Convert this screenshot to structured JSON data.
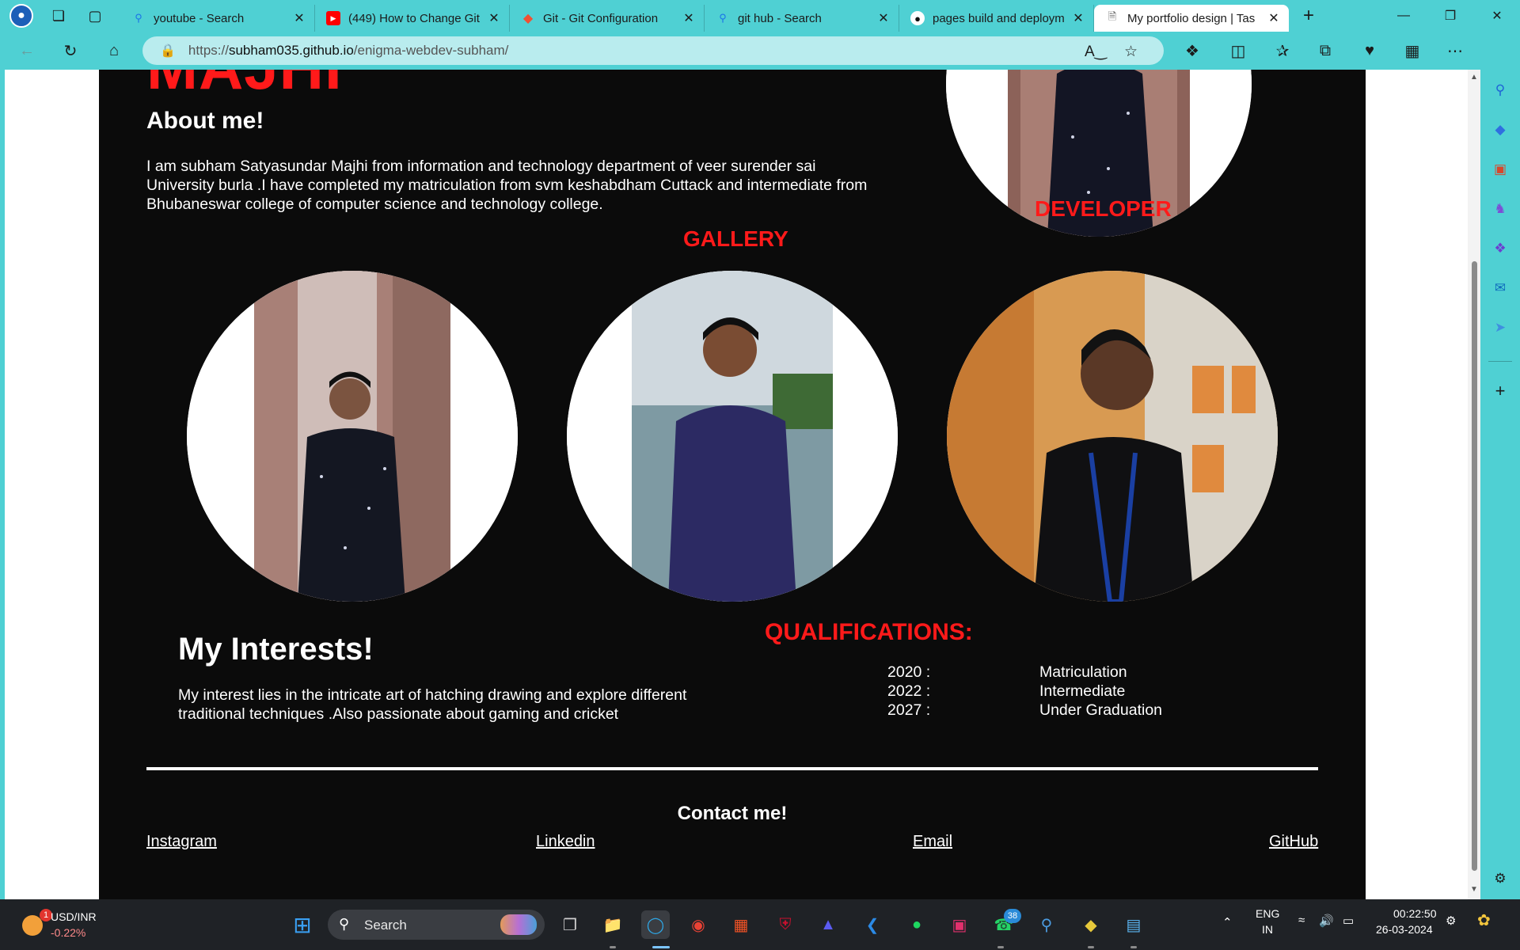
{
  "browser": {
    "tabs": [
      {
        "title": "youtube - Search",
        "favicon": "search-icon",
        "color": "#1a73e8"
      },
      {
        "title": "(449) How to Change Git",
        "favicon": "youtube-icon",
        "color": "#ff0000"
      },
      {
        "title": "Git - Git Configuration",
        "favicon": "git-icon",
        "color": "#f05133"
      },
      {
        "title": "git hub - Search",
        "favicon": "search-icon",
        "color": "#1a73e8"
      },
      {
        "title": "pages build and deploym",
        "favicon": "github-icon",
        "color": "#ffffff"
      },
      {
        "title": "My portfolio design | Tas",
        "favicon": "page-icon",
        "color": "#555555"
      }
    ],
    "url_prefix": "https://",
    "url_host": "subham035.github.io",
    "url_path": "/enigma-webdev-subham/"
  },
  "portfolio": {
    "name": "MAJHI",
    "about_title": "About me!",
    "about_text": "I am subham Satyasundar Majhi from information and technology department of veer surender sai University burla .I have completed my matriculation from svm keshabdham Cuttack and intermediate from Bhubaneswar college of computer science and technology college.",
    "role": "DEVELOPER",
    "gallery_title": "GALLERY",
    "interests_title": "My Interests!",
    "interests_text": "My interest lies in the intricate art of hatching drawing and explore different traditional techniques .Also passionate about gaming and cricket",
    "qualifications_title": "QUALIFICATIONS:",
    "qualifications": [
      {
        "year": "2020 :",
        "level": "Matriculation"
      },
      {
        "year": "2022 :",
        "level": "Intermediate"
      },
      {
        "year": "2027 :",
        "level": "Under Graduation"
      }
    ],
    "contact_title": "Contact me!",
    "links": [
      "Instagram",
      "Linkedin",
      "Email",
      "GitHub"
    ],
    "accent_color": "#ff1a1a"
  },
  "taskbar": {
    "widget_pair": "USD/INR",
    "widget_change": "-0.22%",
    "widget_badge": "1",
    "search_label": "Search",
    "whatsapp_badge": "38",
    "lang_line1": "ENG",
    "lang_line2": "IN",
    "time": "00:22:50",
    "date": "26-03-2024"
  }
}
